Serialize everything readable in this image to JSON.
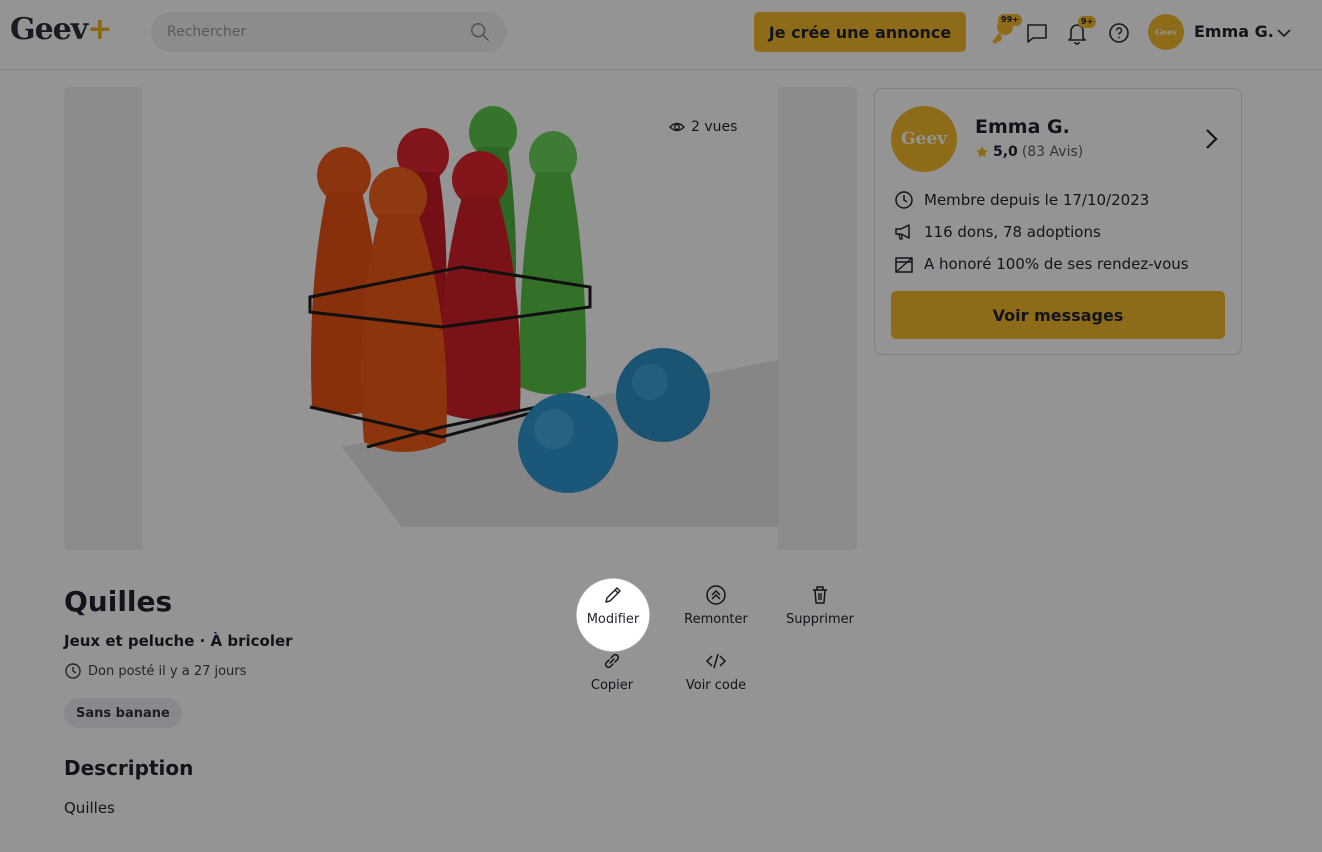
{
  "header": {
    "logo_text": "Geev",
    "logo_plus": "+",
    "search_placeholder": "Rechercher",
    "cta_label": "Je crée une annonce",
    "key_badge": "99+",
    "notif_badge": "9+",
    "user_name": "Emma G.",
    "avatar_text": "Geev"
  },
  "gallery": {
    "views": "2 vues"
  },
  "seller": {
    "avatar_text": "Geev",
    "name": "Emma G.",
    "rating": "5,0",
    "reviews": "(83 Avis)",
    "member_since": "Membre depuis le 17/10/2023",
    "stats": "116 dons, 78 adoptions",
    "honor": "A honoré 100% de ses rendez-vous",
    "button_label": "Voir messages"
  },
  "listing": {
    "title": "Quilles",
    "category": "Jeux et peluche · À bricoler",
    "posted": "Don posté il y a 27 jours",
    "tag": "Sans banane",
    "description_heading": "Description",
    "description": "Quilles"
  },
  "actions": {
    "modifier": "Modifier",
    "remonter": "Remonter",
    "supprimer": "Supprimer",
    "copier": "Copier",
    "voir_code": "Voir code"
  },
  "colors": {
    "accent": "#f3b92b",
    "overlay": "rgba(0,0,0,0.42)"
  }
}
